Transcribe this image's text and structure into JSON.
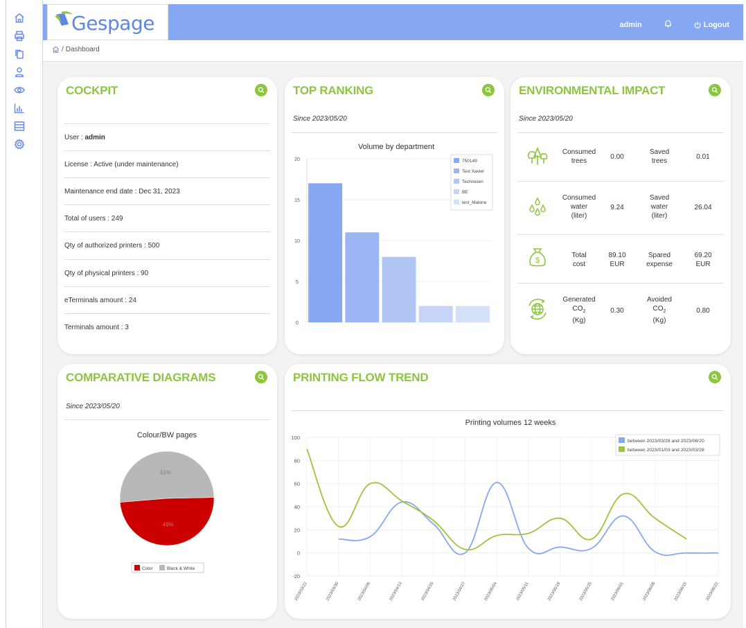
{
  "header": {
    "logo_text": "Gespage",
    "user": "admin",
    "logout": "Logout"
  },
  "breadcrumb": {
    "separator": "/",
    "current": "Dashboard"
  },
  "sidebar": {
    "items": [
      {
        "icon": "home-icon"
      },
      {
        "icon": "printer-icon"
      },
      {
        "icon": "copy-icon"
      },
      {
        "icon": "user-icon"
      },
      {
        "icon": "eye-icon"
      },
      {
        "icon": "bar-chart-icon"
      },
      {
        "icon": "list-icon"
      },
      {
        "icon": "gear-icon"
      }
    ]
  },
  "cockpit": {
    "title": "COCKPIT",
    "user_label": "User :",
    "user_value": "admin",
    "rows": [
      "License : Active (under maintenance)",
      "Maintenance end date : Dec 31, 2023",
      "Total of users : 249",
      "Qty of authorized printers : 500",
      "Qty of physical printers : 90",
      "eTerminals amount : 24",
      "Terminals amount : 3"
    ]
  },
  "top_ranking": {
    "title": "TOP RANKING",
    "since": "Since 2023/05/20"
  },
  "environmental": {
    "title": "ENVIRONMENTAL IMPACT",
    "since": "Since 2023/05/20",
    "rows": [
      {
        "icon": "trees-icon",
        "l1": "Consumed",
        "l1b": "trees",
        "v1": "0.00",
        "l2": "Saved",
        "l2b": "trees",
        "v2": "0.01"
      },
      {
        "icon": "water-drops-icon",
        "l1": "Consumed",
        "l1b": "water",
        "l1c": "(liter)",
        "v1": "9.24",
        "l2": "Saved",
        "l2b": "water",
        "l2c": "(liter)",
        "v2": "26.04"
      },
      {
        "icon": "money-bag-icon",
        "l1": "Total",
        "l1b": "cost",
        "v1a": "89.10",
        "v1b": "EUR",
        "l2": "Spared",
        "l2b": "expense",
        "v2a": "69.20",
        "v2b": "EUR"
      },
      {
        "icon": "globe-recycle-icon",
        "l1": "Generated",
        "l1b": "CO",
        "sub": "2",
        "l1c": "(Kg)",
        "v1": "0.30",
        "l2": "Avoided",
        "l2b": "CO",
        "l2c": "(Kg)",
        "v2": "0.80"
      }
    ]
  },
  "comparative": {
    "title": "COMPARATIVE DIAGRAMS",
    "since": "Since 2023/05/20"
  },
  "printing_flow": {
    "title": "PRINTING FLOW TREND"
  },
  "colors": {
    "accent_green": "#8cc63f",
    "header_blue": "#86a7f1",
    "series_blue": "#86a7f1",
    "series_green": "#9dc43a",
    "pie_red": "#cc0000",
    "pie_gray": "#b8b8b8"
  },
  "chart_data": [
    {
      "type": "bar",
      "title": "Volume by department",
      "categories": [
        "750149",
        "Test Xavier",
        "Technicien",
        "BE",
        "test_Malone"
      ],
      "values": [
        17,
        11,
        8,
        2,
        2
      ],
      "colors": [
        "#86a7f1",
        "#9bb6f3",
        "#b1c6f5",
        "#c6d5f7",
        "#d5e0f9"
      ],
      "ylim": [
        0,
        20
      ],
      "yticks": [
        0,
        5,
        10,
        15,
        20
      ],
      "legend": "top-right"
    },
    {
      "type": "pie",
      "title": "Colour/BW pages",
      "slices": [
        {
          "label": "Color",
          "value": 49,
          "text": "49%",
          "color": "#cc0000"
        },
        {
          "label": "Black & White",
          "value": 51,
          "text": "51%",
          "color": "#b8b8b8"
        }
      ],
      "legend": "bottom"
    },
    {
      "type": "line",
      "title": "Printing volumes 12 weeks",
      "x": [
        "2023/03/22",
        "2023/03/30",
        "2023/04/06",
        "2023/04/13",
        "2023/04/20",
        "2023/04/27",
        "2023/05/04",
        "2023/05/11",
        "2023/05/18",
        "2023/05/25",
        "2023/06/01",
        "2023/06/08",
        "2023/06/15",
        "2023/06/22"
      ],
      "series": [
        {
          "name": "between 2023/03/28 and 2023/06/20",
          "color": "#86a7f1",
          "values": [
            null,
            12,
            14,
            44,
            25,
            0,
            61,
            4,
            5,
            4,
            32,
            1,
            0,
            0
          ]
        },
        {
          "name": "between 2023/01/03 and 2023/03/28",
          "color": "#9dc43a",
          "values": [
            90,
            23,
            60,
            45,
            28,
            3,
            15,
            17,
            30,
            12,
            51,
            30,
            12,
            null
          ]
        }
      ],
      "ylim": [
        -20,
        100
      ],
      "yticks": [
        -20,
        0,
        20,
        40,
        60,
        80,
        100
      ],
      "legend": "top-right",
      "grid": true
    }
  ]
}
